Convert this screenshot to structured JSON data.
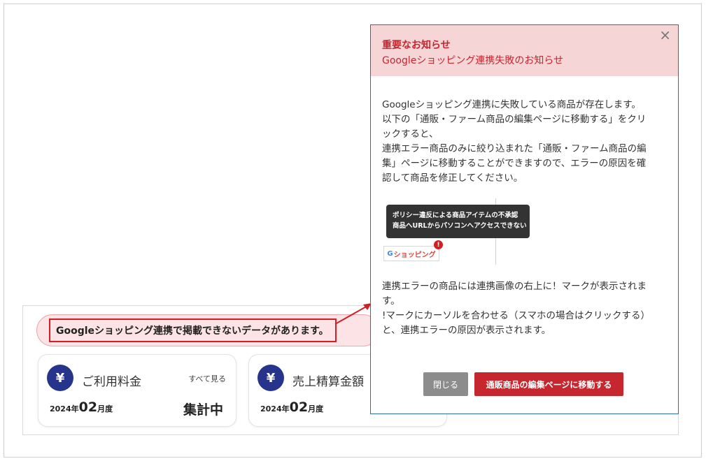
{
  "dashboard": {
    "alert_text": "Googleショッピング連携で掲載できないデータがあります。",
    "cards": [
      {
        "icon": "yen-icon",
        "title": "ご利用料金",
        "link": "すべて見る",
        "period_year": "2024年",
        "period_month": "02",
        "period_suffix": "月度",
        "status": "集計中"
      },
      {
        "icon": "yen-icon",
        "title": "売上精算金額",
        "period_year": "2024年",
        "period_month": "02",
        "period_suffix": "月度"
      }
    ]
  },
  "modal": {
    "title": "重要なお知らせ",
    "subtitle": "Googleショッピング連携失敗のお知らせ",
    "close_glyph": "×",
    "paragraph1": [
      "Googleショッピング連携に失敗している商品が存在します。",
      "以下の「通販・ファーム商品の編集ページに移動する」をクリ",
      "ックすると、",
      "連携エラー商品のみに絞り込まれた「通販・ファーム商品の編",
      "集」ページに移動することができますので、エラーの原因を確",
      "認して商品を修正してください。"
    ],
    "tooltip_lines": [
      "ポリシー違反による商品アイテムの不承認",
      "商品へURLからパソコンへアクセスできない"
    ],
    "gshop_logo": {
      "g": "G",
      "text": "ショッピング"
    },
    "error_badge": "!",
    "paragraph2": [
      "連携エラーの商品には連携画像の右上に！マークが表示されま",
      "す。",
      "!マークにカーソルを合わせる（スマホの場合はクリックする）",
      "と、連携エラーの原因が表示されます。"
    ],
    "close_button": "閉じる",
    "go_button": "通販商品の編集ページに移動する"
  },
  "colors": {
    "accent_red": "#c6262e",
    "navy": "#27348b",
    "modal_header_bg": "#f6d5d7"
  }
}
